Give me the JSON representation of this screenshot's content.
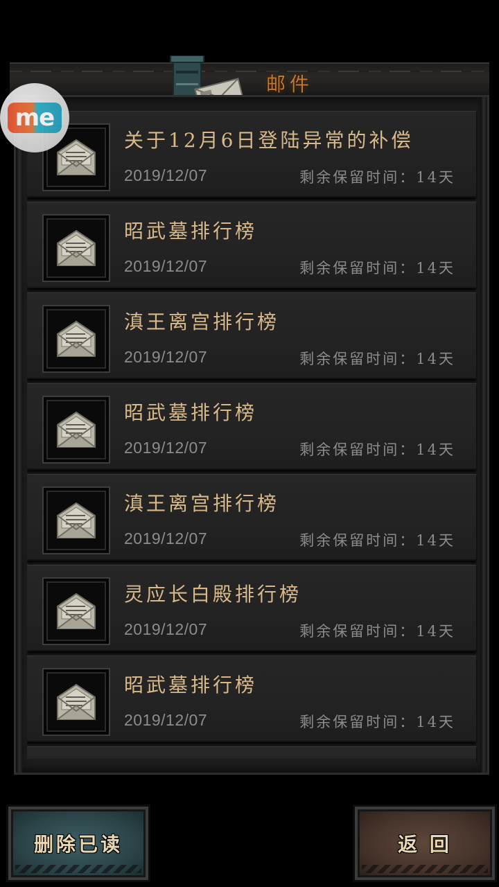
{
  "header": {
    "title": "邮件"
  },
  "badge": {
    "label": "me"
  },
  "mail_items": [
    {
      "title": "关于12月6日登陆异常的补偿",
      "date": "2019/12/07",
      "retention": "剩余保留时间：14天",
      "icon": "envelope-open-icon"
    },
    {
      "title": "昭武墓排行榜",
      "date": "2019/12/07",
      "retention": "剩余保留时间：14天",
      "icon": "envelope-open-icon"
    },
    {
      "title": "滇王离宫排行榜",
      "date": "2019/12/07",
      "retention": "剩余保留时间：14天",
      "icon": "envelope-open-icon"
    },
    {
      "title": "昭武墓排行榜",
      "date": "2019/12/07",
      "retention": "剩余保留时间：14天",
      "icon": "envelope-open-icon"
    },
    {
      "title": "滇王离宫排行榜",
      "date": "2019/12/07",
      "retention": "剩余保留时间：14天",
      "icon": "envelope-open-icon"
    },
    {
      "title": "灵应长白殿排行榜",
      "date": "2019/12/07",
      "retention": "剩余保留时间：14天",
      "icon": "envelope-open-icon"
    },
    {
      "title": "昭武墓排行榜",
      "date": "2019/12/07",
      "retention": "剩余保留时间：14天",
      "icon": "envelope-open-icon"
    }
  ],
  "buttons": {
    "delete_read": "删除已读",
    "back": "返 回"
  },
  "colors": {
    "title_accent": "#c07a32",
    "mail_title": "#d9b98a",
    "meta_text": "#8c8c8c",
    "delete_button": "#2a4448",
    "back_button": "#45332a"
  }
}
